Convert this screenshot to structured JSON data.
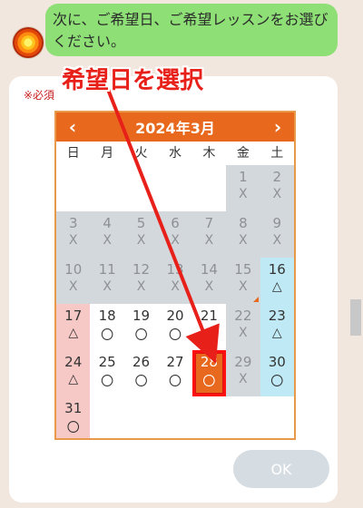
{
  "chat": {
    "message": "次に、ご希望日、ご希望レッスンをお選びください。"
  },
  "form": {
    "required_note": "※必須",
    "ok_label": "OK"
  },
  "calendar": {
    "title": "2024年3月",
    "prev_icon": "chevron-left-icon",
    "next_icon": "chevron-right-icon",
    "weekdays": [
      "日",
      "月",
      "火",
      "水",
      "木",
      "金",
      "土"
    ],
    "leading_blanks": 5,
    "days": [
      {
        "day": "1",
        "status": "X",
        "state": "unavailable"
      },
      {
        "day": "2",
        "status": "X",
        "state": "unavailable"
      },
      {
        "day": "3",
        "status": "X",
        "state": "unavailable"
      },
      {
        "day": "4",
        "status": "X",
        "state": "unavailable"
      },
      {
        "day": "5",
        "status": "X",
        "state": "unavailable"
      },
      {
        "day": "6",
        "status": "X",
        "state": "unavailable"
      },
      {
        "day": "7",
        "status": "X",
        "state": "unavailable"
      },
      {
        "day": "8",
        "status": "X",
        "state": "unavailable"
      },
      {
        "day": "9",
        "status": "X",
        "state": "unavailable"
      },
      {
        "day": "10",
        "status": "X",
        "state": "unavailable"
      },
      {
        "day": "11",
        "status": "X",
        "state": "unavailable"
      },
      {
        "day": "12",
        "status": "X",
        "state": "unavailable"
      },
      {
        "day": "13",
        "status": "X",
        "state": "unavailable"
      },
      {
        "day": "14",
        "status": "X",
        "state": "unavailable"
      },
      {
        "day": "15",
        "status": "X",
        "state": "unavailable",
        "marker": true
      },
      {
        "day": "16",
        "status": "△",
        "state": "saturday"
      },
      {
        "day": "17",
        "status": "△",
        "state": "sunday"
      },
      {
        "day": "18",
        "status": "〇",
        "state": "open"
      },
      {
        "day": "19",
        "status": "〇",
        "state": "open"
      },
      {
        "day": "20",
        "status": "〇",
        "state": "open"
      },
      {
        "day": "21",
        "status": "〇",
        "state": "open"
      },
      {
        "day": "22",
        "status": "X",
        "state": "unavailable"
      },
      {
        "day": "23",
        "status": "△",
        "state": "saturday"
      },
      {
        "day": "24",
        "status": "△",
        "state": "sunday"
      },
      {
        "day": "25",
        "status": "〇",
        "state": "open"
      },
      {
        "day": "26",
        "status": "〇",
        "state": "open"
      },
      {
        "day": "27",
        "status": "〇",
        "state": "open"
      },
      {
        "day": "28",
        "status": "〇",
        "state": "selected"
      },
      {
        "day": "29",
        "status": "X",
        "state": "unavailable"
      },
      {
        "day": "30",
        "status": "〇",
        "state": "saturday"
      },
      {
        "day": "31",
        "status": "〇",
        "state": "sunday"
      }
    ]
  },
  "annotation": {
    "label": "希望日を選択"
  },
  "colors": {
    "header_orange": "#e8691d",
    "bubble_green": "#8ee076",
    "annotation_red": "#e8201a"
  }
}
